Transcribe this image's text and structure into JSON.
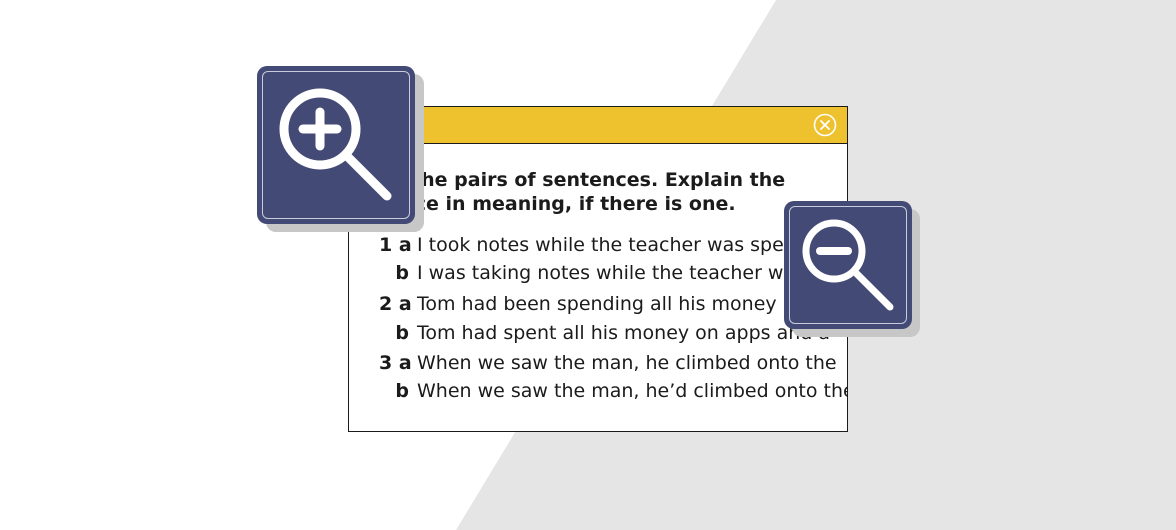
{
  "colors": {
    "background": "#ffffff",
    "background_diagonal": "#e5e5e5",
    "header": "#eec12e",
    "zoom_button": "#434a75",
    "text": "#1b1b1b"
  },
  "dialog": {
    "close_icon": "close-circle-icon",
    "instruction_lines": [
      "ad the pairs of sentences. Explain the",
      "rence in meaning, if there is one."
    ],
    "items": [
      {
        "num": "1 a",
        "text": "I took notes while the teacher was spe"
      },
      {
        "num": "b",
        "text": "I was taking notes while the teacher wa"
      },
      {
        "num": "2 a",
        "text": "Tom had been spending all his money"
      },
      {
        "num": "b",
        "text": "Tom had spent all his money on apps and a"
      },
      {
        "num": "3 a",
        "text": "When we saw the man, he climbed onto the"
      },
      {
        "num": "b",
        "text": "When we saw the man, he’d climbed onto the"
      }
    ]
  },
  "zoom_in": {
    "icon": "zoom-in-icon"
  },
  "zoom_out": {
    "icon": "zoom-out-icon"
  }
}
